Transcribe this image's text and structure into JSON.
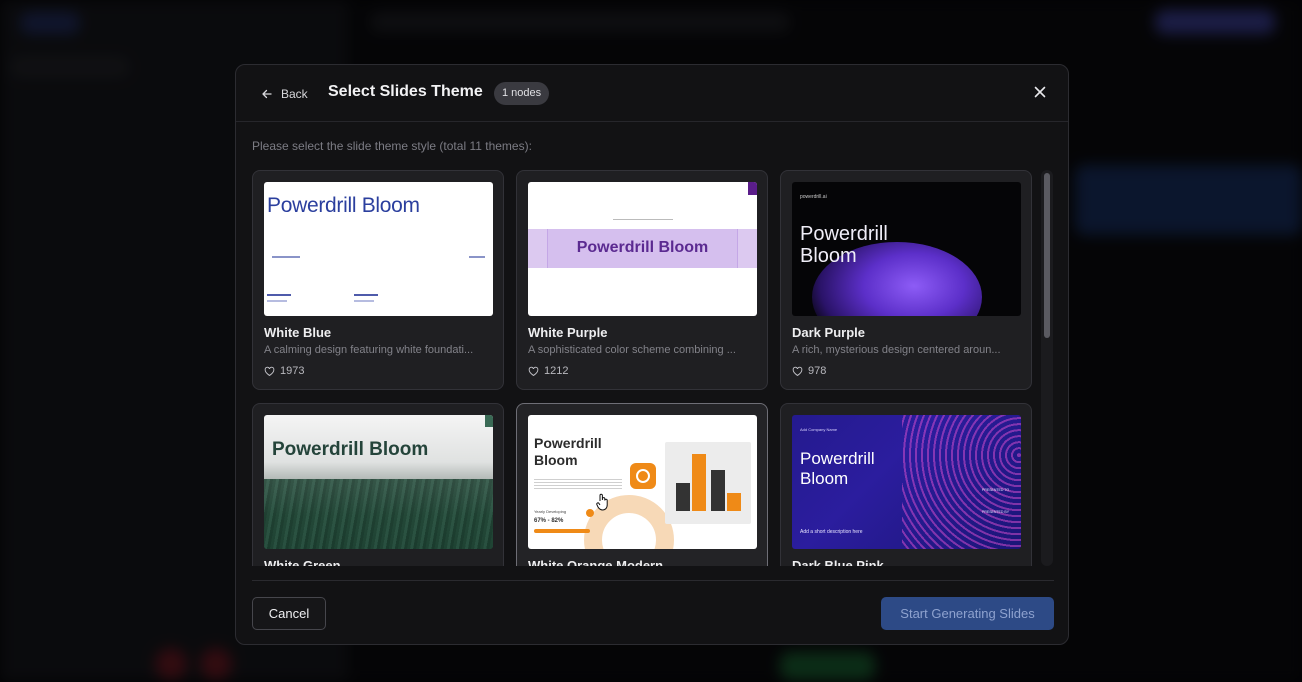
{
  "modal": {
    "back_label": "Back",
    "title": "Select Slides Theme",
    "badge": "1 nodes",
    "hint": "Please select the slide theme style (total 11 themes):",
    "cancel_label": "Cancel",
    "generate_label": "Start Generating Slides"
  },
  "themes": [
    {
      "name": "White Blue",
      "description": "A calming design featuring white foundati...",
      "likes": "1973",
      "thumb_title": "Powerdrill Bloom"
    },
    {
      "name": "White Purple",
      "description": "A sophisticated color scheme combining ...",
      "likes": "1212",
      "thumb_title": "Powerdrill Bloom"
    },
    {
      "name": "Dark Purple",
      "description": "A rich, mysterious design centered aroun...",
      "likes": "978",
      "thumb_title": "Powerdrill Bloom",
      "thumb_logo": "powerdrill.ai"
    },
    {
      "name": "White Green",
      "thumb_title": "Powerdrill Bloom"
    },
    {
      "name": "White Orange Modern",
      "thumb_title": "Powerdrill Bloom",
      "thumb_sub": "Yearly Developing",
      "thumb_pct": "67% - 82%"
    },
    {
      "name": "Dark Blue Pink",
      "thumb_title": "Powerdrill Bloom",
      "thumb_logo": "Add Company Name",
      "thumb_small": "Add a short description here",
      "thumb_r1": "PRESENTED TO",
      "thumb_r2": "PRESENTED BY"
    }
  ],
  "colors": {
    "accent_button": "#2d4a86",
    "modal_bg": "#121214",
    "card_bg": "#1f1f22"
  }
}
